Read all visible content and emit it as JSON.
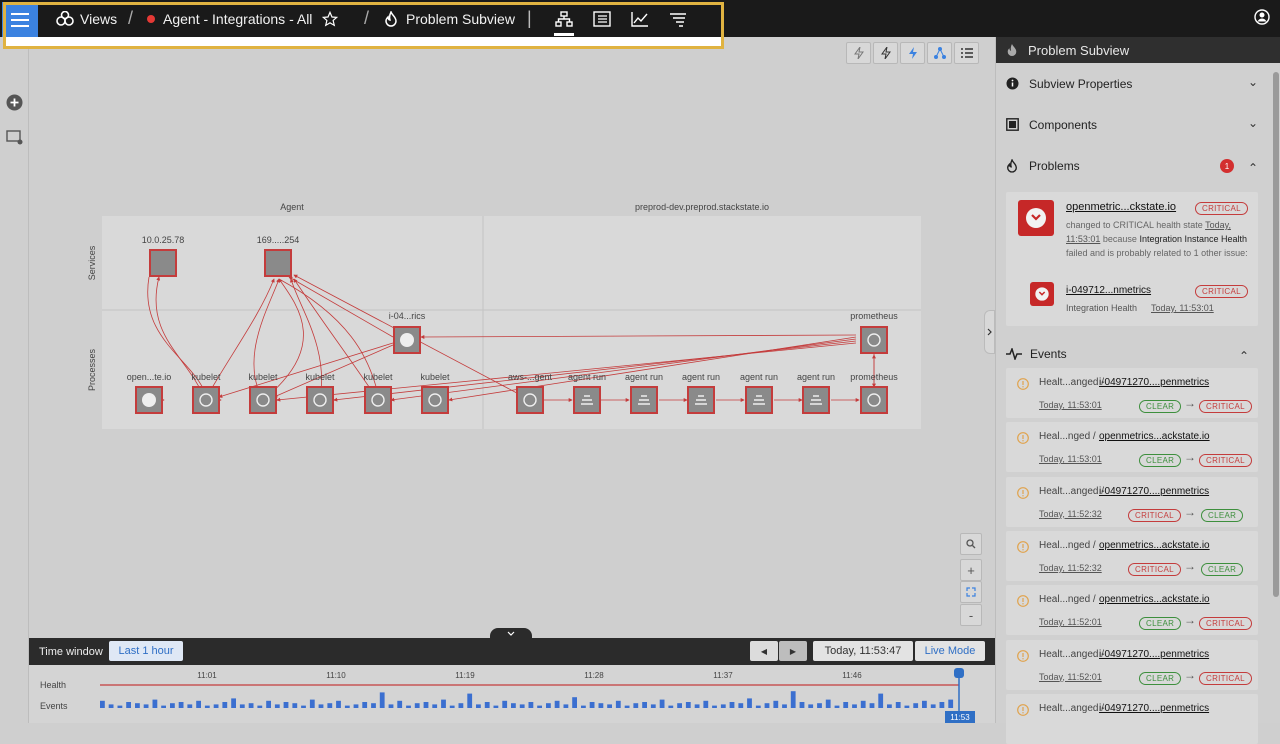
{
  "topbar": {
    "views_label": "Views",
    "view_name": "Agent - Integrations - All",
    "subview_name": "Problem Subview"
  },
  "graph": {
    "col_left": "Agent",
    "col_right": "preprod-dev.preprod.stackstate.io",
    "row_services": "Services",
    "row_processes": "Processes",
    "nodes": {
      "svc1": "10.0.25.78",
      "svc2": "169.....254",
      "mid": "i-04...rics",
      "prom_top": "prometheus",
      "p1": "open...te.io",
      "p2": "kubelet",
      "p3": "kubelet",
      "p4": "kubelet",
      "p5": "kubelet",
      "p6": "kubelet",
      "p7": "aws-...gent",
      "p8": "agent run",
      "p9": "agent run",
      "p10": "agent run",
      "p11": "agent run",
      "p12": "agent run",
      "p13": "prometheus"
    }
  },
  "timeline": {
    "label": "Time window",
    "range_button": "Last 1 hour",
    "current_time": "Today, 11:53:47",
    "live_mode": "Live Mode",
    "health_label": "Health",
    "events_label": "Events",
    "ticks": [
      "11:01",
      "11:10",
      "11:19",
      "11:28",
      "11:37",
      "11:46"
    ],
    "cursor_time": "11:53",
    "event_bars": [
      6,
      3,
      2,
      5,
      4,
      3,
      7,
      2,
      4,
      5,
      3,
      6,
      2,
      3,
      5,
      8,
      3,
      4,
      2,
      6,
      3,
      5,
      4,
      2,
      7,
      3,
      4,
      6,
      2,
      3,
      5,
      4,
      13,
      3,
      6,
      2,
      4,
      5,
      3,
      7,
      2,
      4,
      12,
      3,
      5,
      2,
      6,
      4,
      3,
      5,
      2,
      4,
      6,
      3,
      9,
      2,
      5,
      4,
      3,
      6,
      2,
      4,
      5,
      3,
      7,
      2,
      4,
      5,
      3,
      6,
      2,
      3,
      5,
      4,
      8,
      2,
      4,
      6,
      3,
      14,
      5,
      3,
      4,
      7,
      2,
      5,
      3,
      6,
      4,
      12,
      3,
      5,
      2,
      4,
      6,
      3,
      5,
      7
    ]
  },
  "panel": {
    "title": "Problem Subview",
    "sec_properties": "Subview Properties",
    "sec_components": "Components",
    "sec_problems": "Problems",
    "problems_count": "1",
    "problem": {
      "name": "openmetric...ckstate.io",
      "state": "CRITICAL",
      "t1": "changed to CRITICAL health state",
      "t2": "Today,",
      "t3": "11:53:01",
      "t4": "because",
      "t5": "Integration Instance Health",
      "t6": "failed and is probably related to 1 other issue:",
      "related_name": "i-049712...nmetrics",
      "related_state": "CRITICAL",
      "related_desc": "Integration Health",
      "related_time": "Today, 11:53:01"
    },
    "sec_events": "Events",
    "events": [
      {
        "title": "Healt...anged /",
        "target": "i-04971270....penmetrics",
        "time": "Today, 11:53:01",
        "from": "CLEAR",
        "to": "CRITICAL"
      },
      {
        "title": "Heal...nged /",
        "target": "openmetrics...ackstate.io",
        "time": "Today, 11:53:01",
        "from": "CLEAR",
        "to": "CRITICAL"
      },
      {
        "title": "Healt...anged /",
        "target": "i-04971270....penmetrics",
        "time": "Today, 11:52:32",
        "from": "CRITICAL",
        "to": "CLEAR"
      },
      {
        "title": "Heal...nged /",
        "target": "openmetrics...ackstate.io",
        "time": "Today, 11:52:32",
        "from": "CRITICAL",
        "to": "CLEAR"
      },
      {
        "title": "Heal...nged /",
        "target": "openmetrics...ackstate.io",
        "time": "Today, 11:52:01",
        "from": "CLEAR",
        "to": "CRITICAL"
      },
      {
        "title": "Healt...anged /",
        "target": "i-04971270....penmetrics",
        "time": "Today, 11:52:01",
        "from": "CLEAR",
        "to": "CRITICAL"
      },
      {
        "title": "Healt...anged /",
        "target": "i-04971270....penmetrics",
        "time": "",
        "from": "",
        "to": ""
      }
    ]
  },
  "colors": {
    "accent": "#3b82e0",
    "critical": "#c43c3c",
    "clear": "#3d8f3d",
    "highlight": "#e0b341"
  }
}
